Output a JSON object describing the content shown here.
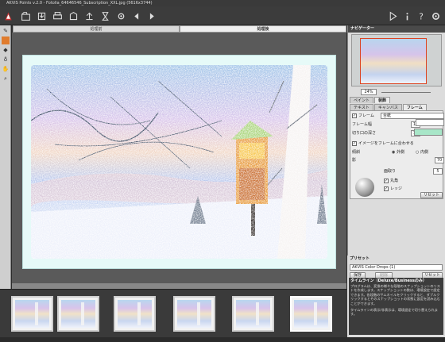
{
  "window": {
    "title": "AKVIS Points v.2.0 - Fotolia_64646546_Subscription_XXL.jpg (5616x3744)"
  },
  "toolbar": {
    "icons": [
      "logo-icon",
      "open-icon",
      "save-icon",
      "print-icon",
      "share-icon",
      "upload-icon",
      "batch-icon",
      "settings-icon",
      "back-icon",
      "forward-icon",
      "run-icon",
      "info-icon",
      "help-icon",
      "preferences-icon"
    ]
  },
  "view_tabs": {
    "before": "処理前",
    "after": "処理後"
  },
  "navigator": {
    "title": "ナビゲーター",
    "zoom": "24%"
  },
  "settings_tabs": {
    "paint": "ペイント",
    "decoration": "装飾"
  },
  "deco_tabs": {
    "text": "テキスト",
    "canvas": "キャンバス",
    "frame": "フレーム"
  },
  "frame": {
    "enable_label": "フレーム",
    "style": "台紙",
    "width_label": "フレーム幅",
    "width_value": "15",
    "cut_depth_label": "切り口の深さ",
    "cut_depth_value": "10",
    "fit_label": "イメージをフレームに合わせる",
    "bevel_label": "傾斜",
    "outer_label": "外側",
    "inner_label": "内側",
    "shadow_label": "影",
    "shadow_value": "70",
    "surface_label": "面取り",
    "surface_value": "5",
    "round_label": "丸角",
    "edge_label": "レッジ",
    "reset": "リセット",
    "swatch1": "#ffffff",
    "swatch2": "#a8e6c8"
  },
  "presets": {
    "title": "プリセット",
    "current": "AKVIS Color Drops (1)",
    "save": "保存",
    "delete": "削除",
    "reset": "リセット"
  },
  "help": {
    "title": "タイムライン（Deluxe/Businessのみ）",
    "text": "プログラムは、変換の様々な段階のスナップショットのリストを作成します。スナップショットの数は、環境設定で設定できます。各段階のサムネイルをクリックすると、ダブルクリックするとそのスナップショットの状態に設定を読み込むことができます。",
    "footer": "タイムラインの表示/非表示は、環境設定で切り替えられます。"
  },
  "filmstrip": {
    "count": 6,
    "selected_index": 5
  }
}
